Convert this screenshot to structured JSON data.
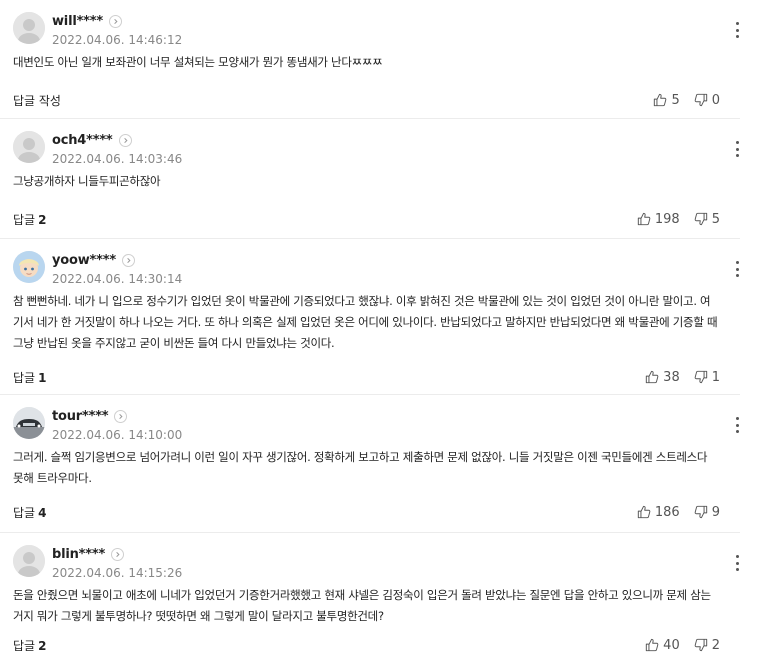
{
  "comments": [
    {
      "nick": "will****",
      "date": "2022.04.06. 14:46:12",
      "text": "대변인도 아닌 일개 보좌관이 너무 설쳐되는 모양새가 뭔가 똥냄새가 난다ㅉㅉㅉ",
      "reply_label": "답글 작성",
      "reply_count": "",
      "likes": "5",
      "dislikes": "0",
      "avatar": "default-avatar"
    },
    {
      "nick": "och4****",
      "date": "2022.04.06. 14:03:46",
      "text": "그냥공개하자 니들두피곤하잖아",
      "reply_label": "답글",
      "reply_count": "2",
      "likes": "198",
      "dislikes": "5",
      "avatar": "default-avatar"
    },
    {
      "nick": "yoow****",
      "date": "2022.04.06. 14:30:14",
      "text": "참 뻔뻔하네. 네가 니 입으로 정수기가 입었던 옷이 박물관에 기증되었다고 했잖냐. 이후 밝혀진 것은 박물관에 있는 것이 입었던 것이 아니란 말이고. 여기서 네가 한 거짓말이 하나 나오는 거다. 또 하나 의혹은 실제 입었던 옷은 어디에 있나이다. 반납되었다고 말하지만 반납되었다면 왜 박물관에 기증할 때 그냥 반납된 옷을 주지않고 굳이 비싼돈 들여 다시 만들었냐는 것이다.",
      "reply_label": "답글",
      "reply_count": "1",
      "likes": "38",
      "dislikes": "1",
      "avatar": "character-avatar"
    },
    {
      "nick": "tour****",
      "date": "2022.04.06. 14:10:00",
      "text": "그러게. 슬쩍 임기응변으로 넘어가려니 이런 일이 자꾸 생기잖어. 정확하게 보고하고 제출하면 문제 없잖아. 니들 거짓말은 이젠 국민들에겐 스트레스다 못해 트라우마다.",
      "reply_label": "답글",
      "reply_count": "4",
      "likes": "186",
      "dislikes": "9",
      "avatar": "car-avatar"
    },
    {
      "nick": "blin****",
      "date": "2022.04.06. 14:15:26",
      "text": "돈을 안줬으면 뇌물이고 애초에 니네가 입었던거 기증한거라했했고 현재 샤넬은 김정숙이 입은거 돌려 받았냐는 질문엔 답을 안하고 있으니까 문제 삼는거지 뭐가 그렇게 불투명하나? 떳떳하면 왜 그렇게 말이 달라지고 불투명한건데?",
      "reply_label": "답글",
      "reply_count": "2",
      "likes": "40",
      "dislikes": "2",
      "avatar": "default-avatar"
    }
  ]
}
